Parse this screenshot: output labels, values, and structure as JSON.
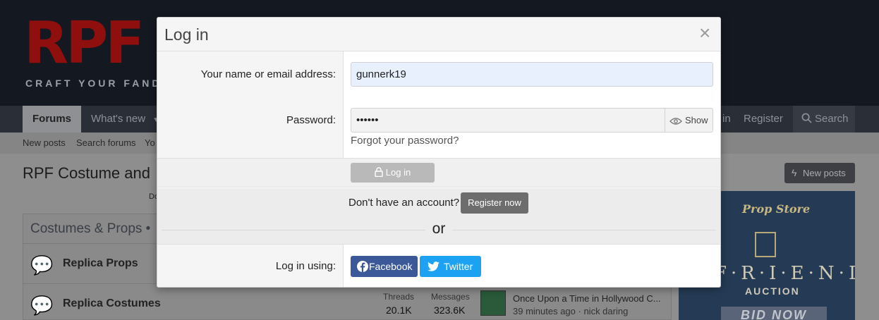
{
  "site": {
    "logo_text": "RPF",
    "tagline": "CRAFT YOUR FAND",
    "nav": {
      "forums": "Forums",
      "whats_new": "What's new",
      "login_partial": "in",
      "register": "Register",
      "search": "Search"
    },
    "subnav": [
      "New posts",
      "Search forums",
      "Yo"
    ],
    "page_title": "RPF Costume and",
    "new_posts_button": "New posts",
    "panel_title": "Costumes & Props •",
    "nodes": [
      {
        "title": "Replica Props"
      },
      {
        "title": "Replica Costumes",
        "threads_label": "Threads",
        "threads": "20.1K",
        "messages_label": "Messages",
        "messages": "323.6K",
        "latest_title": "Once Upon a Time in Hollywood C...",
        "latest_meta": "39 minutes ago · nick daring"
      }
    ],
    "fragment": "Do"
  },
  "ad": {
    "brand": "Prop Store",
    "title": "F·R·I·E·N·D·S",
    "subtitle": "AUCTION",
    "cta": "BID NOW"
  },
  "modal": {
    "title": "Log in",
    "close_icon": "close-icon",
    "name_label": "Your name or email address:",
    "name_value": "gunnerk19",
    "password_label": "Password:",
    "password_value": "••••••",
    "show_label": "Show",
    "forgot_link": "Forgot your password?",
    "login_button": "Log in",
    "register_question": "Don't have an account?",
    "register_button": "Register now",
    "or_text": "or",
    "social_label": "Log in using:",
    "facebook": "Facebook",
    "twitter": "Twitter"
  },
  "colors": {
    "facebook": "#3b5998",
    "twitter": "#1da1f2",
    "login_button": "#b9b9b9",
    "register_button": "#6d6d6d"
  }
}
